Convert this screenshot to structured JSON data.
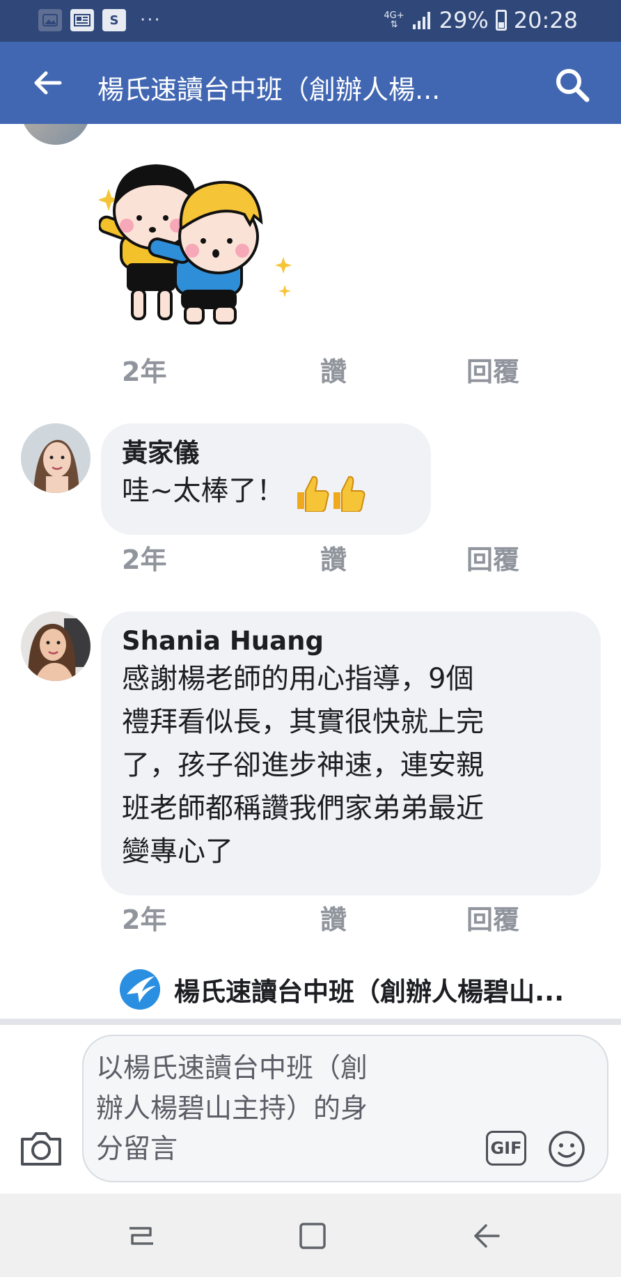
{
  "status_bar": {
    "icons": [
      "gallery-icon",
      "news-icon",
      "s-app-icon",
      "more-dots-icon"
    ],
    "s_label": "S",
    "more": "···",
    "network": "4G+",
    "battery": "29%",
    "time": "20:28"
  },
  "header": {
    "title": "楊氏速讀台中班（創辦人楊...",
    "back_icon": "back-arrow-icon",
    "search_icon": "search-icon"
  },
  "comments": [
    {
      "type": "sticker",
      "sticker_icon": "cartoon-kids-sticker",
      "time": "2年",
      "like": "讚",
      "reply": "回覆"
    },
    {
      "author": "黃家儀",
      "text": "哇~太棒了！",
      "emoji": "thumbs-up-icon",
      "time": "2年",
      "like": "讚",
      "reply": "回覆"
    },
    {
      "author": "Shania Huang",
      "lines": [
        "感謝楊老師的用心指導，9個",
        "禮拜看似長，其實很快就上完",
        "了，孩子卻進步神速，連安親",
        "班老師都稱讚我們家弟弟最近",
        "變專心了"
      ],
      "time": "2年",
      "like": "讚",
      "reply": "回覆"
    }
  ],
  "page_reply": {
    "name": "楊氏速讀台中班（創辦人楊碧山..."
  },
  "composer": {
    "placeholder_lines": [
      "以楊氏速讀台中班（創",
      "辦人楊碧山主持）的身",
      "分留言"
    ],
    "gif_label": "GIF",
    "camera_icon": "camera-icon",
    "emoji_icon": "smiley-icon"
  },
  "nav_bar": {
    "icons": [
      "recent-apps-icon",
      "home-icon",
      "back-icon"
    ]
  },
  "colors": {
    "header": "#4267b2",
    "status_bar": "#2f4779",
    "bubble": "#f1f2f6",
    "meta": "#90949c"
  }
}
